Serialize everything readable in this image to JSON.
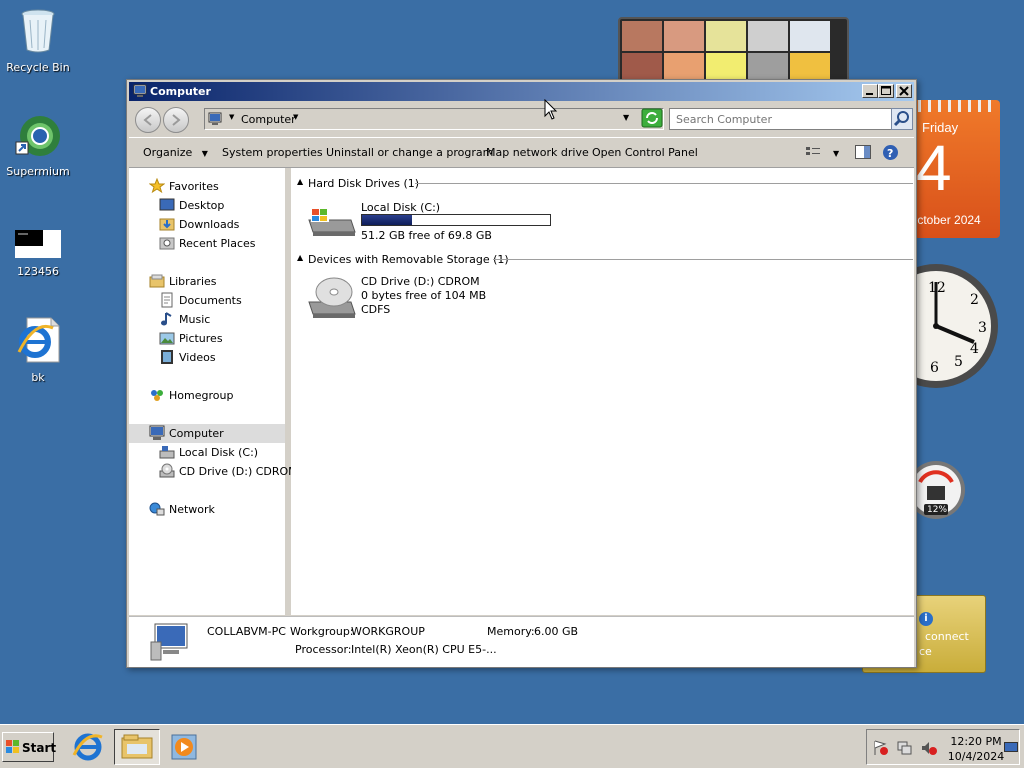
{
  "desktop": {
    "icons": [
      {
        "label": "Recycle Bin",
        "icon": "recycle-bin-icon"
      },
      {
        "label": "Supermium",
        "icon": "supermium-icon"
      },
      {
        "label": "123456",
        "icon": "image-file-icon"
      },
      {
        "label": "bk",
        "icon": "ie-shortcut-icon"
      }
    ]
  },
  "gadgets": {
    "calendar": {
      "day": "Friday",
      "date": "4",
      "month": "October 2024"
    },
    "cpu_meter": {
      "value": "12%"
    },
    "currency": {
      "text": "connect",
      "text2": "ce"
    }
  },
  "window": {
    "title": "Computer",
    "address": {
      "crumb": "Computer"
    },
    "search": {
      "placeholder": "Search Computer"
    },
    "toolbar": {
      "organize": "Organize",
      "system_properties": "System properties",
      "uninstall": "Uninstall or change a program",
      "map_drive": "Map network drive",
      "control_panel": "Open Control Panel"
    },
    "nav": {
      "favorites": "Favorites",
      "desktop": "Desktop",
      "downloads": "Downloads",
      "recent": "Recent Places",
      "libraries": "Libraries",
      "documents": "Documents",
      "music": "Music",
      "pictures": "Pictures",
      "videos": "Videos",
      "homegroup": "Homegroup",
      "computer": "Computer",
      "local_disk": "Local Disk (C:)",
      "cd_drive": "CD Drive (D:) CDROM",
      "network": "Network"
    },
    "groups": {
      "hdd": "Hard Disk Drives (1)",
      "removable": "Devices with Removable Storage (1)"
    },
    "drives": {
      "c": {
        "name": "Local Disk (C:)",
        "free": "51.2 GB free of 69.8 GB",
        "used_fraction": 0.266
      },
      "d": {
        "name": "CD Drive (D:) CDROM",
        "free": "0 bytes free of 104 MB",
        "fs": "CDFS"
      }
    },
    "details": {
      "computer_name": "COLLABVM-PC",
      "workgroup_label": "Workgroup:",
      "workgroup": "WORKGROUP",
      "memory_label": "Memory:",
      "memory": "6.00 GB",
      "processor_label": "Processor:",
      "processor": "Intel(R) Xeon(R) CPU E5-..."
    }
  },
  "taskbar": {
    "start": "Start",
    "time": "12:20 PM",
    "date": "10/4/2024"
  }
}
